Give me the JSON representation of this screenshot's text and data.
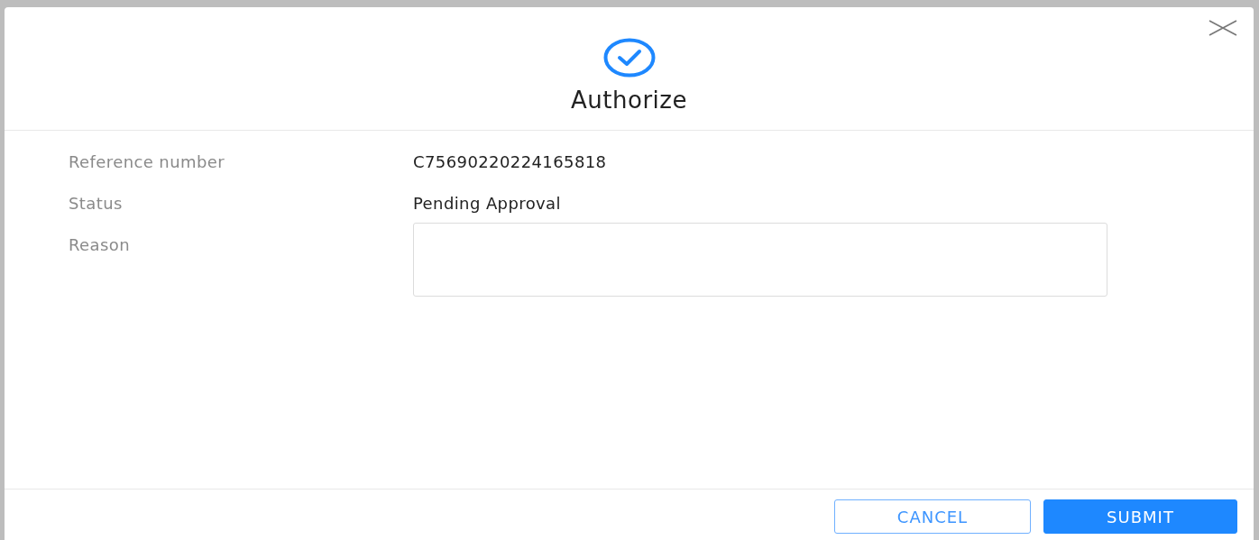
{
  "dialog": {
    "title": "Authorize",
    "closable": true
  },
  "fields": [
    {
      "label": "Reference number",
      "kind": "text",
      "value": "C75690220224165818"
    },
    {
      "label": "Status",
      "kind": "text",
      "value": "Pending Approval"
    },
    {
      "label": "Reason",
      "kind": "textarea"
    }
  ],
  "buttons": [
    {
      "label": "CANCEL",
      "kind": "secondary"
    },
    {
      "label": "SUBMIT",
      "kind": "primary"
    }
  ]
}
